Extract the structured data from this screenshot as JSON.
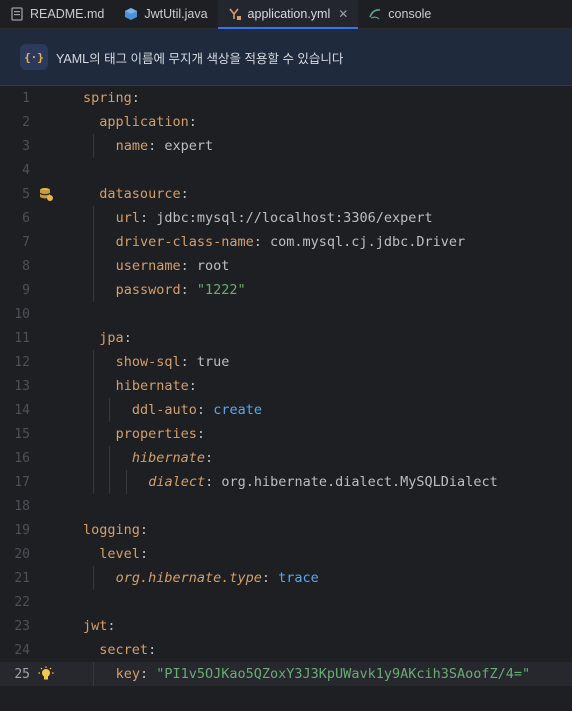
{
  "tabs": [
    {
      "label": "README.md",
      "icon": "markdown-file-icon"
    },
    {
      "label": "JwtUtil.java",
      "icon": "java-class-icon"
    },
    {
      "label": "application.yml",
      "icon": "yaml-file-icon",
      "active": true
    },
    {
      "label": "console",
      "icon": "database-console-icon"
    }
  ],
  "banner": {
    "icon_text": "{·}",
    "text": "YAML의 태그 이름에 무지개 색상을 적용할 수 있습니다"
  },
  "current_line": 25,
  "lines": [
    {
      "n": "1",
      "tokens": [
        [
          "key",
          "spring"
        ],
        [
          "colon",
          ":"
        ]
      ]
    },
    {
      "n": "2",
      "tokens": [
        [
          "key",
          "application"
        ],
        [
          "colon",
          ":"
        ]
      ]
    },
    {
      "n": "3",
      "tokens": [
        [
          "key",
          "name"
        ],
        [
          "colon",
          ": "
        ],
        [
          "plain",
          "expert"
        ]
      ]
    },
    {
      "n": "4",
      "tokens": []
    },
    {
      "n": "5",
      "tokens": [
        [
          "key",
          "datasource"
        ],
        [
          "colon",
          ":"
        ]
      ],
      "marker": "datasource-icon"
    },
    {
      "n": "6",
      "tokens": [
        [
          "key",
          "url"
        ],
        [
          "colon",
          ": "
        ],
        [
          "plain",
          "jdbc:mysql://localhost:3306/expert"
        ]
      ]
    },
    {
      "n": "7",
      "tokens": [
        [
          "key",
          "driver-class-name"
        ],
        [
          "colon",
          ": "
        ],
        [
          "plain",
          "com.mysql.cj.jdbc.Driver"
        ]
      ]
    },
    {
      "n": "8",
      "tokens": [
        [
          "key",
          "username"
        ],
        [
          "colon",
          ": "
        ],
        [
          "plain",
          "root"
        ]
      ]
    },
    {
      "n": "9",
      "tokens": [
        [
          "key",
          "password"
        ],
        [
          "colon",
          ": "
        ],
        [
          "str",
          "\"1222\""
        ]
      ]
    },
    {
      "n": "10",
      "tokens": []
    },
    {
      "n": "11",
      "tokens": [
        [
          "key",
          "jpa"
        ],
        [
          "colon",
          ":"
        ]
      ]
    },
    {
      "n": "12",
      "tokens": [
        [
          "key",
          "show-sql"
        ],
        [
          "colon",
          ": "
        ],
        [
          "plain",
          "true"
        ]
      ]
    },
    {
      "n": "13",
      "tokens": [
        [
          "key",
          "hibernate"
        ],
        [
          "colon",
          ":"
        ]
      ]
    },
    {
      "n": "14",
      "tokens": [
        [
          "key",
          "ddl-auto"
        ],
        [
          "colon",
          ": "
        ],
        [
          "kw",
          "create"
        ]
      ]
    },
    {
      "n": "15",
      "tokens": [
        [
          "key",
          "properties"
        ],
        [
          "colon",
          ":"
        ]
      ]
    },
    {
      "n": "16",
      "tokens": [
        [
          "ikey",
          "hibernate"
        ],
        [
          "colon",
          ":"
        ]
      ]
    },
    {
      "n": "17",
      "tokens": [
        [
          "ikey",
          "dialect"
        ],
        [
          "colon",
          ": "
        ],
        [
          "plain",
          "org.hibernate.dialect.MySQLDialect"
        ]
      ]
    },
    {
      "n": "18",
      "tokens": []
    },
    {
      "n": "19",
      "tokens": [
        [
          "key",
          "logging"
        ],
        [
          "colon",
          ":"
        ]
      ]
    },
    {
      "n": "20",
      "tokens": [
        [
          "key",
          "level"
        ],
        [
          "colon",
          ":"
        ]
      ]
    },
    {
      "n": "21",
      "tokens": [
        [
          "ikey",
          "org.hibernate.type"
        ],
        [
          "colon",
          ": "
        ],
        [
          "kw",
          "trace"
        ]
      ]
    },
    {
      "n": "22",
      "tokens": []
    },
    {
      "n": "23",
      "tokens": [
        [
          "key",
          "jwt"
        ],
        [
          "colon",
          ":"
        ]
      ]
    },
    {
      "n": "24",
      "tokens": [
        [
          "key",
          "secret"
        ],
        [
          "colon",
          ":"
        ]
      ]
    },
    {
      "n": "25",
      "tokens": [
        [
          "key",
          "key"
        ],
        [
          "colon",
          ": "
        ],
        [
          "str",
          "\"PI1v5OJKao5QZoxY3J3KpUWavk1y9AKcih3SAoofZ/4=\""
        ]
      ],
      "marker": "lightbulb-icon"
    }
  ],
  "colors": {
    "key": "#d39f6a",
    "string": "#6aab73",
    "keyword": "#56a8f5",
    "accent": "#3574f0"
  }
}
